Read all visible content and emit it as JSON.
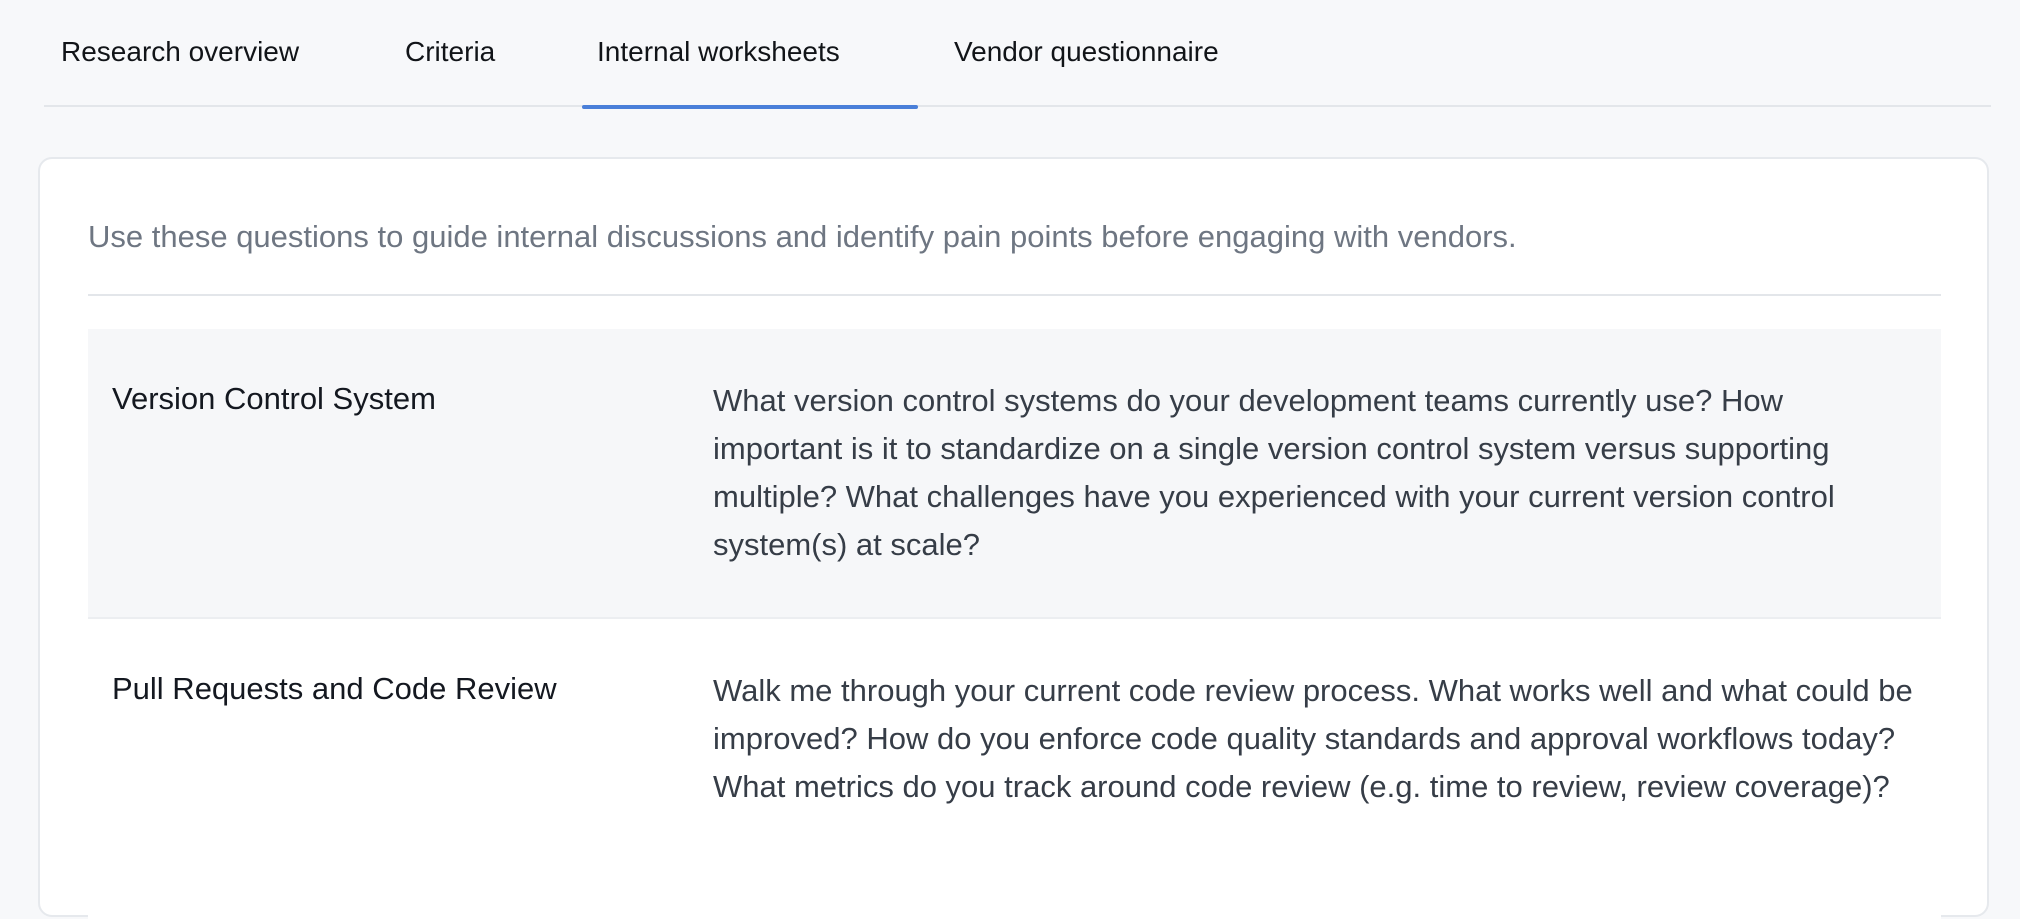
{
  "tabs": [
    {
      "label": "Research overview",
      "active": false
    },
    {
      "label": "Criteria",
      "active": false
    },
    {
      "label": "Internal worksheets",
      "active": true
    },
    {
      "label": "Vendor questionnaire",
      "active": false
    }
  ],
  "colors": {
    "active_tab_underline": "#4a7fd9",
    "page_background": "#f7f8fa",
    "muted_text": "#6e7682"
  },
  "worksheet": {
    "intro": "Use these questions to guide internal discussions and identify pain points before engaging with vendors.",
    "rows": [
      {
        "title": "Version Control System",
        "question": "What version control systems do your development teams currently use? How important is it to standardize on a single version control system versus supporting multiple? What challenges have you experienced with your current version control system(s) at scale?"
      },
      {
        "title": "Pull Requests and Code Review",
        "question": "Walk me through your current code review process. What works well and what could be improved? How do you enforce code quality standards and approval workflows today? What metrics do you track around code review (e.g. time to review, review coverage)?"
      }
    ]
  }
}
